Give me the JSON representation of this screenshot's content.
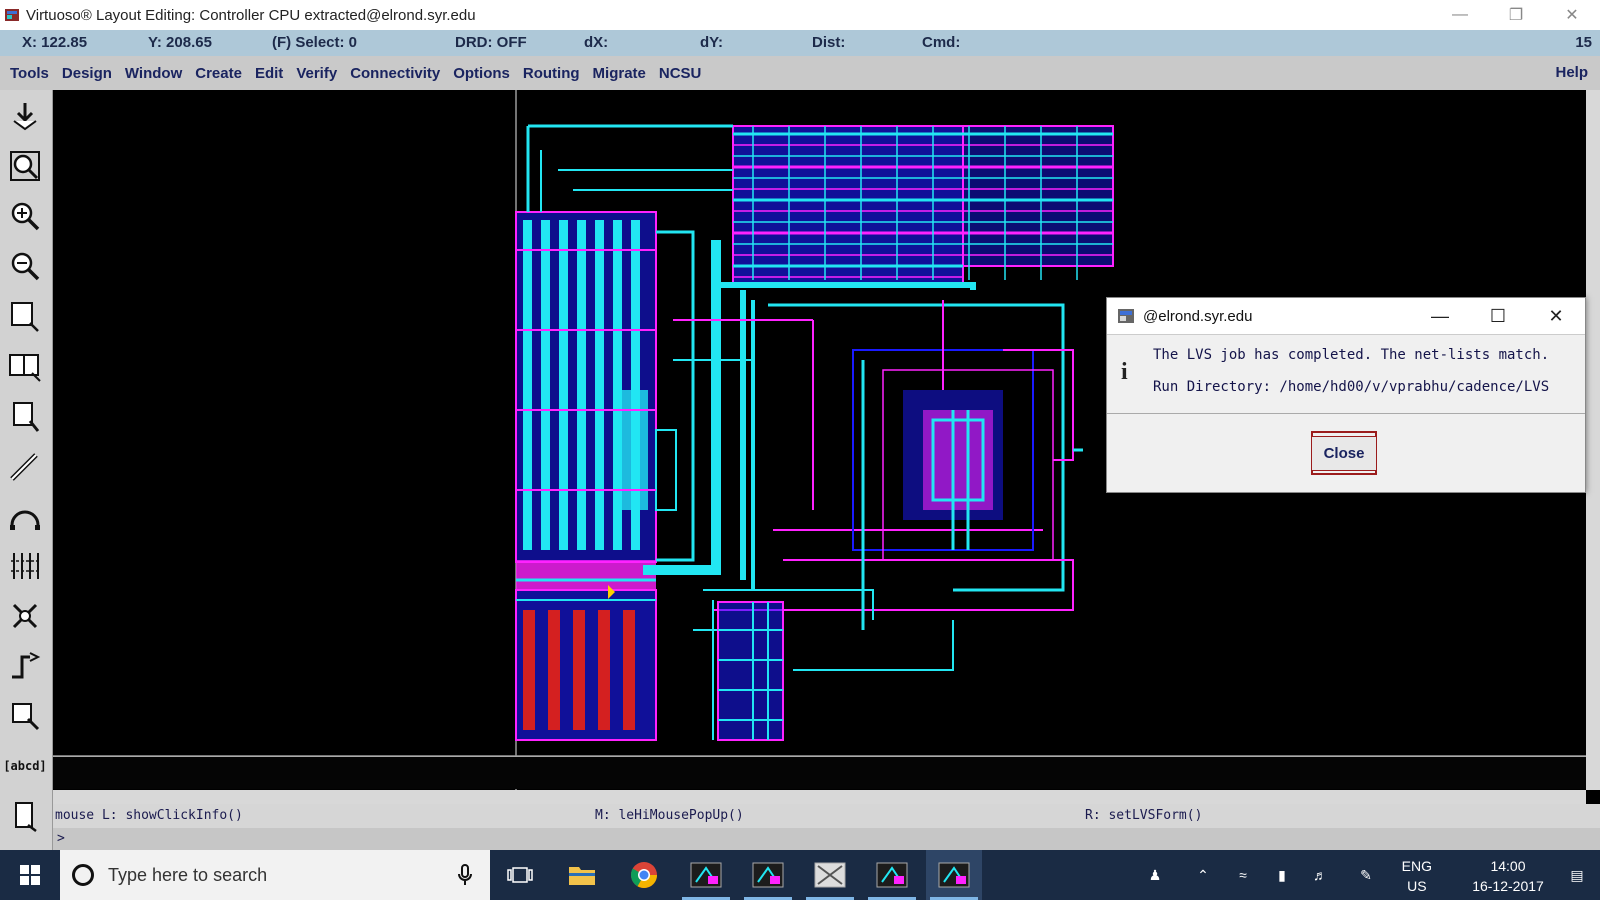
{
  "window": {
    "title": "Virtuoso® Layout Editing: Controller CPU extracted@elrond.syr.edu"
  },
  "status": {
    "x": "X: 122.85",
    "y": "Y: 208.65",
    "select": "(F) Select: 0",
    "drd": "DRD: OFF",
    "dx": "dX:",
    "dy": "dY:",
    "dist": "Dist:",
    "cmd": "Cmd:",
    "count": "15"
  },
  "menu": {
    "items": [
      "Tools",
      "Design",
      "Window",
      "Create",
      "Edit",
      "Verify",
      "Connectivity",
      "Options",
      "Routing",
      "Migrate",
      "NCSU"
    ],
    "help": "Help"
  },
  "toolbar": {
    "tools": [
      "save-icon",
      "fit-view-icon",
      "zoom-in-icon",
      "zoom-out-icon",
      "stretch-icon",
      "copy-icon",
      "move-icon",
      "path-icon",
      "arc-icon",
      "align-icon",
      "properties-icon",
      "wire-icon",
      "rectangle-icon",
      "label-icon",
      "ruler-icon"
    ],
    "label_tool": "[abcd]"
  },
  "mouse": {
    "left": "mouse L: showClickInfo()",
    "middle": "M: leHiMousePopUp()",
    "right": "R: setLVSForm()"
  },
  "prompt": {
    "text": ">"
  },
  "dialog": {
    "title": "@elrond.syr.edu",
    "message": "The LVS job has completed. The net-lists match.",
    "run_dir": "Run Directory: /home/hd00/v/vprabhu/cadence/LVS",
    "close_label": "Close"
  },
  "taskbar": {
    "search_placeholder": "Type here to search",
    "lang_top": "ENG",
    "lang_bottom": "US",
    "time": "14:00",
    "date": "16-12-2017"
  },
  "colors": {
    "metal1": "#1a1aff",
    "metal2": "#ff22ff",
    "metal3": "#22e6f2",
    "status_bg": "#aec8d8",
    "menu_bg": "#c9c9c9"
  }
}
